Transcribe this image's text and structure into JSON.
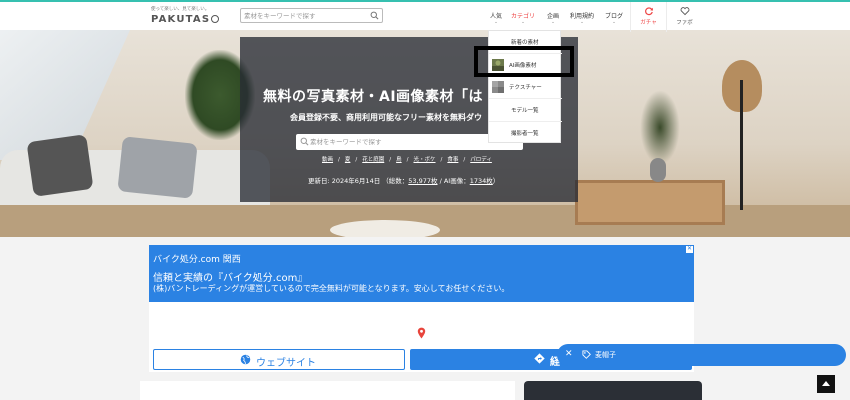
{
  "header": {
    "logo_tagline": "使って楽しい、見て楽しい。",
    "logo_text": "PAKUTAS",
    "search_placeholder": "素材をキーワードで探す",
    "nav": [
      {
        "label": "人気",
        "chevron": "⌄",
        "active": false
      },
      {
        "label": "カテゴリ",
        "chevron": "⌄",
        "active": true
      },
      {
        "label": "企画",
        "chevron": "⌄",
        "active": false
      },
      {
        "label": "利用規約",
        "chevron": "⌄",
        "active": false
      },
      {
        "label": "ブログ",
        "chevron": "⌄",
        "active": false
      }
    ],
    "gacha_label": "ガチャ",
    "fav_label": "ファボ",
    "accent_color": "#e44444"
  },
  "dropdown": {
    "items": [
      {
        "label": "新着の素材",
        "icon": null
      },
      {
        "label": "AI画像素材",
        "icon": "ai-thumbnail-icon"
      },
      {
        "label": "テクスチャー",
        "icon": "texture-thumbnail-icon"
      },
      {
        "label": "モデル一覧",
        "icon": null
      },
      {
        "label": "撮影者一覧",
        "icon": null
      }
    ]
  },
  "hero": {
    "title": "無料の写真素材・AI画像素材「は",
    "subtitle": "会員登録不要、商用利用可能なフリー素材を無料ダウ",
    "search_placeholder": "素材をキーワードで探す",
    "tags": [
      "動画",
      "夏",
      "花と庭園",
      "鳥",
      "光・ボケ",
      "食事",
      "パロディ"
    ],
    "updated_prefix": "更新日: 2024年6月14日 （総数：",
    "total_count": "53,977枚",
    "ai_prefix": " / AI画像：",
    "ai_count": "1734枚",
    "updated_suffix": "）"
  },
  "ad": {
    "line1": "バイク処分.com 関西",
    "line2": "信頼と実績の『バイク処分.com』",
    "line3": "(株)バントレーディングが運営しているので完全無料が可能となります。安心してお任せください。",
    "close": "✕",
    "web_button": "ウェブサイト",
    "route_button": "経",
    "brand_color": "#2b82e3"
  },
  "chip": {
    "close": "✕",
    "label": "麦帽子"
  }
}
